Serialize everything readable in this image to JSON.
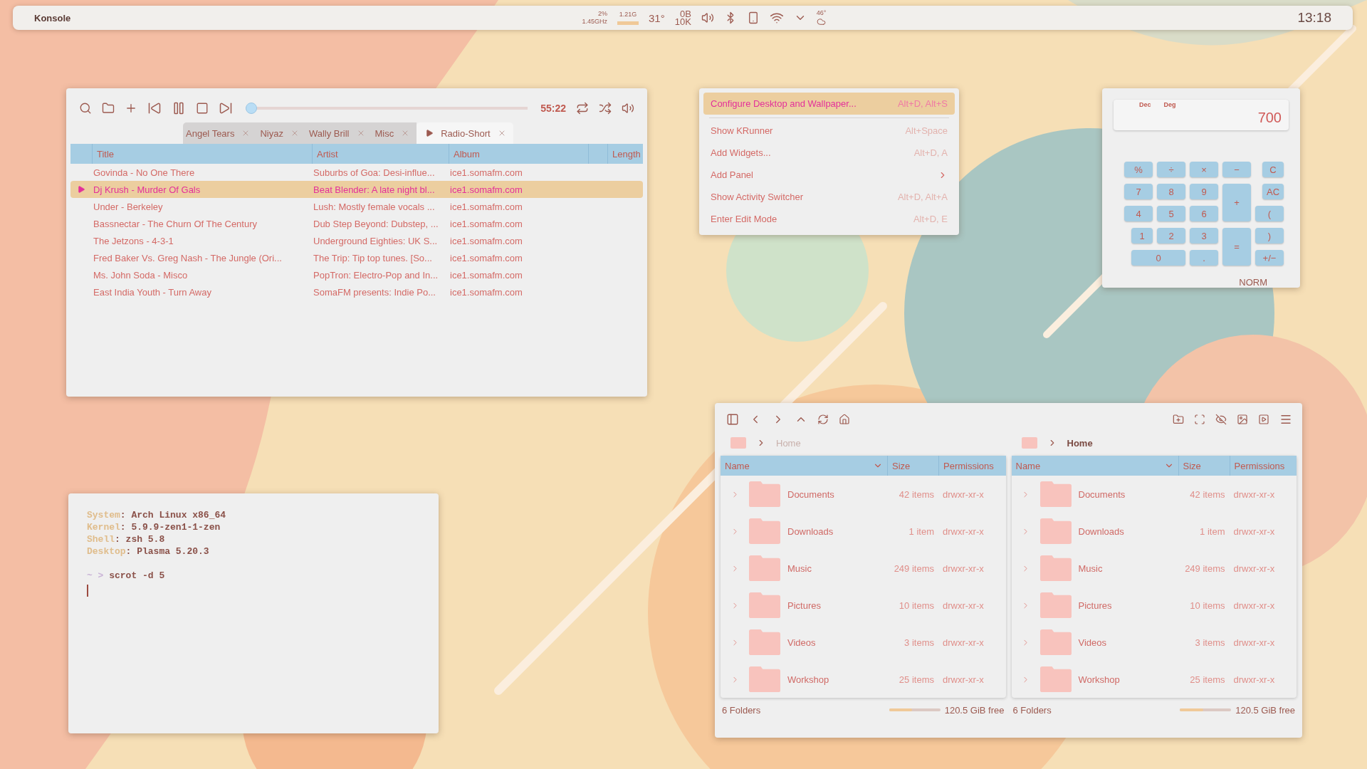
{
  "panel": {
    "title": "Konsole",
    "cpu_usage": "2%",
    "cpu_freq": "1.45GHz",
    "memory": "1.21G",
    "temperature": "31°",
    "net_up": "0B",
    "net_down": "10K",
    "weather_temp": "46°",
    "clock": "13:18"
  },
  "player": {
    "time": "55:22",
    "seek": {
      "level": 0.0
    },
    "tabs": [
      {
        "label": "Angel Tears",
        "selected": false
      },
      {
        "label": "Niyaz",
        "selected": false
      },
      {
        "label": "Wally Brill",
        "selected": false
      },
      {
        "label": "Misc",
        "selected": false
      },
      {
        "label": "Radio-Short",
        "selected": true
      }
    ],
    "columns": [
      "Title",
      "Artist",
      "Album",
      "Length"
    ],
    "rows": [
      {
        "title": "Govinda - No One There",
        "artist": "Suburbs of Goa: Desi-influe...",
        "album": "ice1.somafm.com",
        "selected": false
      },
      {
        "title": "Dj Krush - Murder Of Gals",
        "artist": "Beat Blender: A late night bl...",
        "album": "ice1.somafm.com",
        "selected": true
      },
      {
        "title": "Under - Berkeley",
        "artist": "Lush: Mostly female vocals ...",
        "album": "ice1.somafm.com",
        "selected": false
      },
      {
        "title": "Bassnectar - The Churn Of The Century",
        "artist": "Dub Step Beyond: Dubstep, ...",
        "album": "ice1.somafm.com",
        "selected": false
      },
      {
        "title": "The Jetzons - 4-3-1",
        "artist": "Underground Eighties: UK S...",
        "album": "ice1.somafm.com",
        "selected": false
      },
      {
        "title": "Fred Baker Vs. Greg Nash - The Jungle (Ori...",
        "artist": "The Trip:  Tip top tunes. [So...",
        "album": "ice1.somafm.com",
        "selected": false
      },
      {
        "title": "Ms. John Soda - Misco",
        "artist": "PopTron: Electro-Pop and In...",
        "album": "ice1.somafm.com",
        "selected": false
      },
      {
        "title": "East India Youth - Turn Away",
        "artist": "SomaFM presents: Indie Po...",
        "album": "ice1.somafm.com",
        "selected": false
      }
    ]
  },
  "menu": {
    "items": [
      {
        "label": "Configure Desktop and Wallpaper...",
        "shortcut": "Alt+D, Alt+S",
        "selected": true,
        "submenu": false
      },
      {
        "label": "Show KRunner",
        "shortcut": "Alt+Space",
        "selected": false,
        "submenu": false
      },
      {
        "label": "Add Widgets...",
        "shortcut": "Alt+D, A",
        "selected": false,
        "submenu": false
      },
      {
        "label": "Add Panel",
        "selected": false,
        "submenu": true
      },
      {
        "label": "Show Activity Switcher",
        "shortcut": "Alt+D, Alt+A",
        "selected": false,
        "submenu": false
      },
      {
        "label": "Enter Edit Mode",
        "shortcut": "Alt+D, E",
        "selected": false,
        "submenu": false
      }
    ]
  },
  "calculator": {
    "base": "Dec",
    "angle": "Deg",
    "display": "700",
    "mode": "NORM",
    "keys": [
      {
        "label": "%",
        "kind": "normal"
      },
      {
        "label": "÷",
        "kind": "normal"
      },
      {
        "label": "×",
        "kind": "normal"
      },
      {
        "label": "−",
        "kind": "normal"
      },
      {
        "label": "C",
        "kind": "normal"
      },
      {
        "label": "7",
        "kind": "normal"
      },
      {
        "label": "8",
        "kind": "normal"
      },
      {
        "label": "9",
        "kind": "normal"
      },
      {
        "label": "+",
        "kind": "tall"
      },
      {
        "label": "AC",
        "kind": "normal"
      },
      {
        "label": "4",
        "kind": "normal"
      },
      {
        "label": "5",
        "kind": "normal"
      },
      {
        "label": "6",
        "kind": "normal"
      },
      {
        "label": "(",
        "kind": "normal"
      },
      {
        "label": "1",
        "kind": "normal"
      },
      {
        "label": "2",
        "kind": "normal"
      },
      {
        "label": "3",
        "kind": "normal"
      },
      {
        "label": "=",
        "kind": "tall"
      },
      {
        "label": ")",
        "kind": "normal"
      },
      {
        "label": "0",
        "kind": "wide"
      },
      {
        "label": ".",
        "kind": "normal"
      },
      {
        "label": "+/−",
        "kind": "normal"
      }
    ]
  },
  "terminal": {
    "lines": [
      {
        "kind": "info",
        "key": "System",
        "value": ": Arch Linux x86_64"
      },
      {
        "kind": "info",
        "key": "Kernel",
        "value": ": 5.9.9-zen1-1-zen"
      },
      {
        "kind": "info",
        "key": "Shell",
        "value": ": zsh 5.8"
      },
      {
        "kind": "info",
        "key": "Desktop",
        "value": ": Plasma 5.20.3"
      },
      {
        "kind": "blank"
      },
      {
        "kind": "prompt",
        "prompt": "~ >",
        "command": "scrot -d 5"
      }
    ]
  },
  "file_manager": {
    "panes": [
      {
        "active": false,
        "location": "Home",
        "columns": [
          "Name",
          "Size",
          "Permissions"
        ],
        "rows": [
          {
            "name": "Documents",
            "size": "42 items",
            "permissions": "drwxr-xr-x"
          },
          {
            "name": "Downloads",
            "size": "1 item",
            "permissions": "drwxr-xr-x"
          },
          {
            "name": "Music",
            "size": "249 items",
            "permissions": "drwxr-xr-x"
          },
          {
            "name": "Pictures",
            "size": "10 items",
            "permissions": "drwxr-xr-x"
          },
          {
            "name": "Videos",
            "size": "3 items",
            "permissions": "drwxr-xr-x"
          },
          {
            "name": "Workshop",
            "size": "25 items",
            "permissions": "drwxr-xr-x"
          }
        ],
        "status": "6 Folders",
        "free": "120.5 GiB free",
        "level": 0.45
      },
      {
        "active": true,
        "location": "Home",
        "columns": [
          "Name",
          "Size",
          "Permissions"
        ],
        "rows": [
          {
            "name": "Documents",
            "size": "42 items",
            "permissions": "drwxr-xr-x"
          },
          {
            "name": "Downloads",
            "size": "1 item",
            "permissions": "drwxr-xr-x"
          },
          {
            "name": "Music",
            "size": "249 items",
            "permissions": "drwxr-xr-x"
          },
          {
            "name": "Pictures",
            "size": "10 items",
            "permissions": "drwxr-xr-x"
          },
          {
            "name": "Videos",
            "size": "3 items",
            "permissions": "drwxr-xr-x"
          },
          {
            "name": "Workshop",
            "size": "25 items",
            "permissions": "drwxr-xr-x"
          }
        ],
        "status": "6 Folders",
        "free": "120.5 GiB free",
        "level": 0.45
      }
    ]
  }
}
